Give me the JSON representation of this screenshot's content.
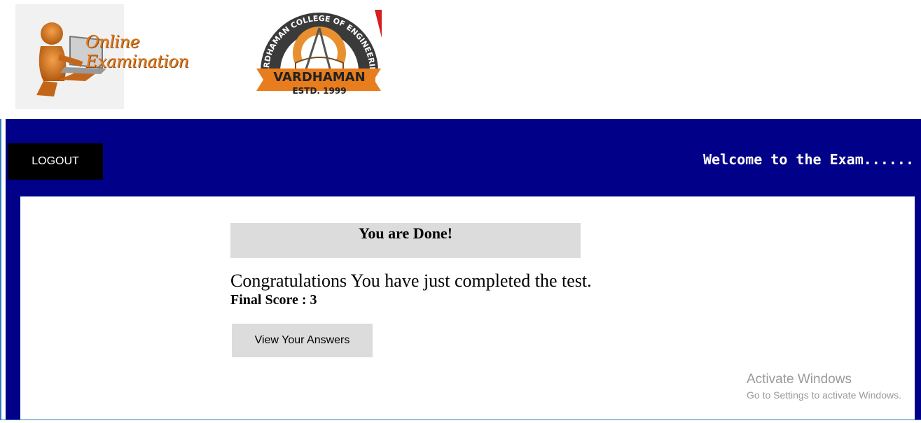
{
  "header": {
    "left_logo_title": "Online Examination",
    "college_logo": {
      "arc_text": "VARDHAMAN COLLEGE OF ENGINEERING",
      "banner": "VARDHAMAN",
      "estd": "ESTD. 1999"
    }
  },
  "navbar": {
    "logout_label": "LOGOUT",
    "welcome_text": "Welcome to the Exam......"
  },
  "result": {
    "heading": "You are Done!",
    "message": "Congratulations You have just completed the test.",
    "score_text": "Final Score  : 3",
    "view_answers_label": "View Your Answers"
  },
  "watermark": {
    "line1": "Activate Windows",
    "line2": "Go to Settings to activate Windows."
  },
  "colors": {
    "navbar": "#000088",
    "logout_bg": "#000000",
    "box_gray": "#dcdcdc",
    "logo_orange": "#e07a1f"
  }
}
